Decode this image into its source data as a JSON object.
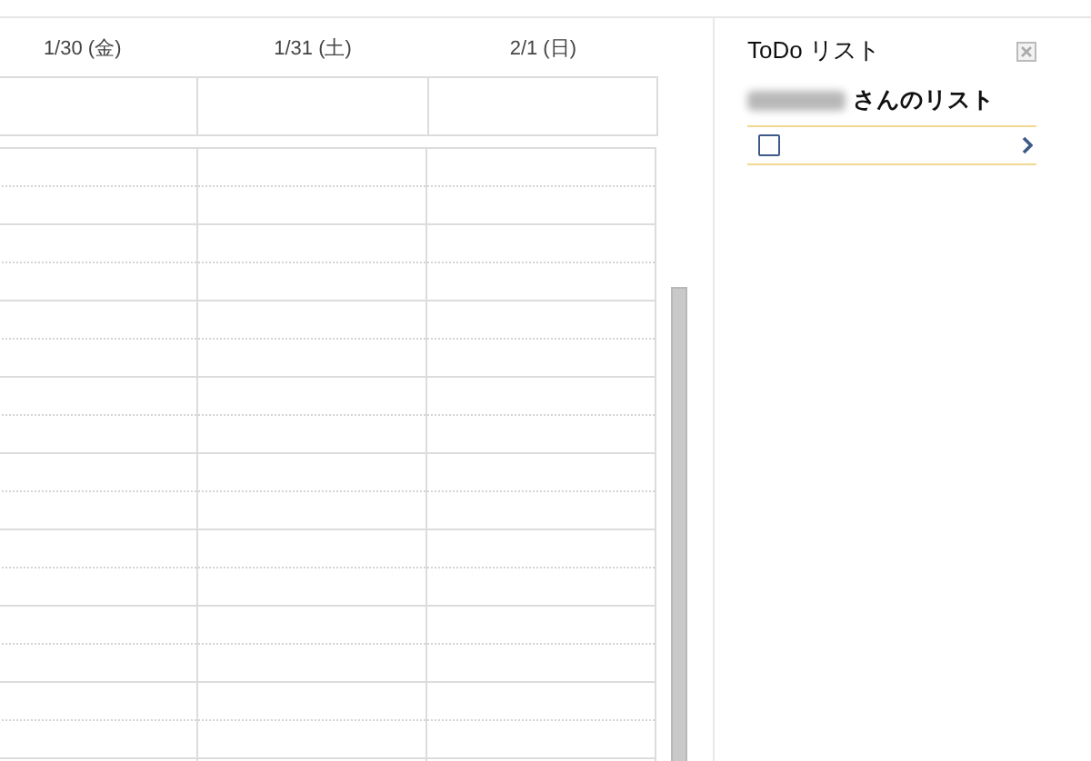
{
  "calendar": {
    "day_headers": [
      "1/30 (金)",
      "1/31 (土)",
      "2/1 (日)"
    ]
  },
  "todo_panel": {
    "title": "ToDo リスト",
    "owner_suffix": "さんのリスト",
    "items": [
      {
        "checked": false
      }
    ]
  }
}
